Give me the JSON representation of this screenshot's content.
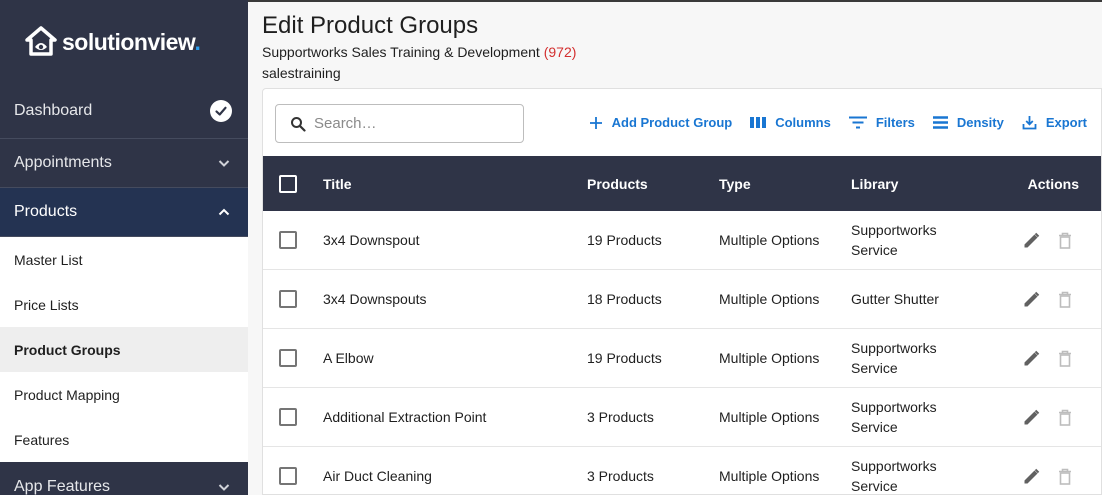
{
  "brand": {
    "name_part1": "solution",
    "name_part2": "view"
  },
  "sidebar": {
    "dashboard": "Dashboard",
    "sections": [
      {
        "label": "Appointments"
      },
      {
        "label": "Products"
      }
    ],
    "product_items": [
      {
        "label": "Master List"
      },
      {
        "label": "Price Lists"
      },
      {
        "label": "Product Groups"
      },
      {
        "label": "Product Mapping"
      },
      {
        "label": "Features"
      }
    ],
    "app_features": "App Features"
  },
  "header": {
    "title": "Edit Product Groups",
    "company": "Supportworks Sales Training & Development",
    "company_count": "(972)",
    "username": "salestraining"
  },
  "toolbar": {
    "search_placeholder": "Search…",
    "add": "Add Product Group",
    "columns": "Columns",
    "filters": "Filters",
    "density": "Density",
    "export": "Export"
  },
  "table": {
    "columns": {
      "title": "Title",
      "products": "Products",
      "type": "Type",
      "library": "Library",
      "actions": "Actions"
    },
    "rows": [
      {
        "title": "3x4 Downspout",
        "products": "19 Products",
        "type": "Multiple Options",
        "library": "Supportworks Service"
      },
      {
        "title": "3x4 Downspouts",
        "products": "18 Products",
        "type": "Multiple Options",
        "library": "Gutter Shutter"
      },
      {
        "title": "A Elbow",
        "products": "19 Products",
        "type": "Multiple Options",
        "library": "Supportworks Service"
      },
      {
        "title": "Additional Extraction Point",
        "products": "3 Products",
        "type": "Multiple Options",
        "library": "Supportworks Service"
      },
      {
        "title": "Air Duct Cleaning",
        "products": "3 Products",
        "type": "Multiple Options",
        "library": "Supportworks Service"
      }
    ]
  },
  "colors": {
    "sidebar": "#2f3447",
    "active_section": "#243352",
    "accent": "#1976d2",
    "count": "#d32f2f"
  }
}
